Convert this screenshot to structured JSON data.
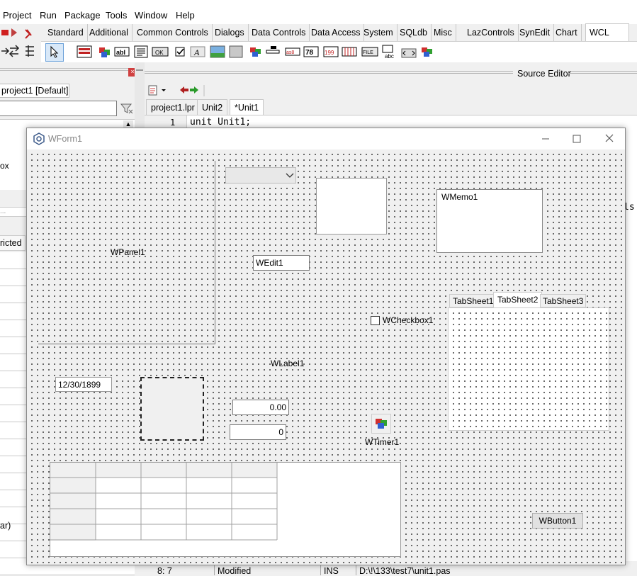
{
  "menu": [
    "Project",
    "Run",
    "Package",
    "Tools",
    "Window",
    "Help"
  ],
  "palette": {
    "tabs": [
      "Standard",
      "Additional",
      "Common Controls",
      "Dialogs",
      "Data Controls",
      "Data Access",
      "System",
      "SQLdb",
      "Misc",
      "LazControls",
      "SynEdit",
      "Chart",
      "WCL"
    ],
    "active_tab": "WCL",
    "icon_labels": [
      "OK",
      "abI",
      "FILE"
    ]
  },
  "left_panel": {
    "project_label": "project1 [Default]",
    "fragment_ox": "ox",
    "fragment_ricted": "ricted",
    "fragment_ar": "ar)",
    "fragment_dots": "..."
  },
  "source_editor": {
    "title": "Source Editor",
    "tabs": [
      "project1.lpr",
      "Unit2",
      "*Unit1"
    ],
    "active_tab": "*Unit1",
    "line_number": "1",
    "code_line": "unit Unit1;",
    "right_fragment": "ls"
  },
  "status": {
    "position": "8: 7",
    "modified": "Modified",
    "mode": "INS",
    "path": "D:\\!\\133\\test7\\unit1.pas"
  },
  "form": {
    "title": "WForm1",
    "panel_caption": "WPanel1",
    "edit_text": "WEdit1",
    "memo_text": "WMemo1",
    "checkbox_label": "WCheckbox1",
    "label_text": "WLabel1",
    "date_text": "12/30/1899",
    "float_text": "0.00",
    "int_text": "0",
    "timer_label": "WTimer1",
    "button_label": "WButton1",
    "tabs": [
      "TabSheet1",
      "TabSheet2",
      "TabSheet3"
    ],
    "active_tab": "TabSheet2"
  }
}
